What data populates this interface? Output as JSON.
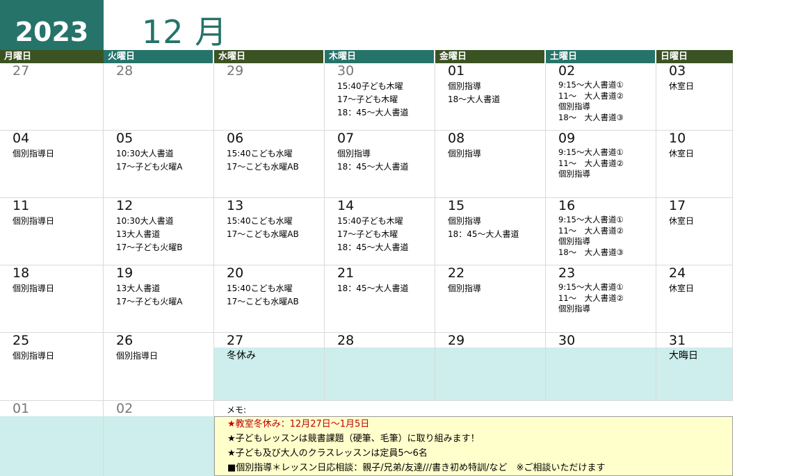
{
  "header": {
    "year": "2023",
    "month": "12 月"
  },
  "weekdays": [
    "月曜日",
    "火曜日",
    "水曜日",
    "木曜日",
    "金曜日",
    "土曜日",
    "日曜日"
  ],
  "weeks": [
    [
      {
        "day": "27",
        "events": []
      },
      {
        "day": "28",
        "events": []
      },
      {
        "day": "29",
        "events": []
      },
      {
        "day": "30",
        "events": [
          "15:40子ども木曜",
          "17～子ども木曜",
          "18：45～大人書道"
        ]
      },
      {
        "day": "01",
        "events": [
          "個別指導",
          "18～大人書道"
        ]
      },
      {
        "day": "02",
        "events": [
          "9:15～大人書道①",
          "11～　大人書道②",
          "個別指導",
          "18～　大人書道③"
        ]
      },
      {
        "day": "03",
        "events": [
          "休室日"
        ]
      }
    ],
    [
      {
        "day": "04",
        "events": [
          "個別指導日"
        ]
      },
      {
        "day": "05",
        "events": [
          "10:30大人書道",
          "17～子ども火曜A"
        ]
      },
      {
        "day": "06",
        "events": [
          "15:40こども水曜",
          "17～こども水曜AB"
        ]
      },
      {
        "day": "07",
        "events": [
          "個別指導",
          "18：45～大人書道"
        ]
      },
      {
        "day": "08",
        "events": [
          "個別指導"
        ]
      },
      {
        "day": "09",
        "events": [
          "9:15～大人書道①",
          "11～　大人書道②",
          "個別指導"
        ]
      },
      {
        "day": "10",
        "events": [
          "休室日"
        ]
      }
    ],
    [
      {
        "day": "11",
        "events": [
          "個別指導日"
        ]
      },
      {
        "day": "12",
        "events": [
          "10:30大人書道",
          "13大人書道",
          "17～子ども火曜B"
        ]
      },
      {
        "day": "13",
        "events": [
          "15:40こども水曜",
          "17～こども水曜AB"
        ]
      },
      {
        "day": "14",
        "events": [
          "15:40子ども木曜",
          "17～子ども木曜",
          "18：45～大人書道"
        ]
      },
      {
        "day": "15",
        "events": [
          "個別指導",
          "18：45～大人書道"
        ]
      },
      {
        "day": "16",
        "events": [
          "9:15～大人書道①",
          "11～　大人書道②",
          "個別指導",
          "18～　大人書道③"
        ]
      },
      {
        "day": "17",
        "events": [
          "休室日"
        ]
      }
    ],
    [
      {
        "day": "18",
        "events": [
          "個別指導日"
        ]
      },
      {
        "day": "19",
        "events": [
          "13大人書道",
          "17～子ども火曜A"
        ]
      },
      {
        "day": "20",
        "events": [
          "15:40こども水曜",
          "17～こども水曜AB"
        ]
      },
      {
        "day": "21",
        "events": [
          "18：45～大人書道"
        ]
      },
      {
        "day": "22",
        "events": [
          "個別指導"
        ]
      },
      {
        "day": "23",
        "events": [
          "9:15～大人書道①",
          "11～　大人書道②",
          "個別指導"
        ]
      },
      {
        "day": "24",
        "events": [
          "休室日"
        ]
      }
    ],
    [
      {
        "day": "25",
        "events": [
          "個別指導日"
        ]
      },
      {
        "day": "26",
        "events": [
          "個別指導日"
        ]
      },
      {
        "day": "27",
        "events": [
          "冬休み"
        ]
      },
      {
        "day": "28",
        "events": []
      },
      {
        "day": "29",
        "events": []
      },
      {
        "day": "30",
        "events": []
      },
      {
        "day": "31",
        "events": [
          "大晦日"
        ]
      }
    ],
    [
      {
        "day": "01",
        "events": []
      },
      {
        "day": "02",
        "events": []
      }
    ]
  ],
  "memo": {
    "label": "メモ:",
    "lines": [
      "★教室冬休み：12月27日～1月5日",
      "★子どもレッスンは競書課題（硬筆、毛筆）に取り組みます！",
      "★子ども及び大人のクラスレッスンは定員5～6名",
      "■個別指導＊レッスン日応相談：親子/兄弟/友達///書き初め特訓/など　※ご相談いただけます"
    ]
  },
  "colors": {
    "teal": "#26736a",
    "dark_green": "#3b5323",
    "holiday_band": "#cdeeed",
    "memo_bg": "#ffffcc",
    "memo_red": "#c00000"
  }
}
